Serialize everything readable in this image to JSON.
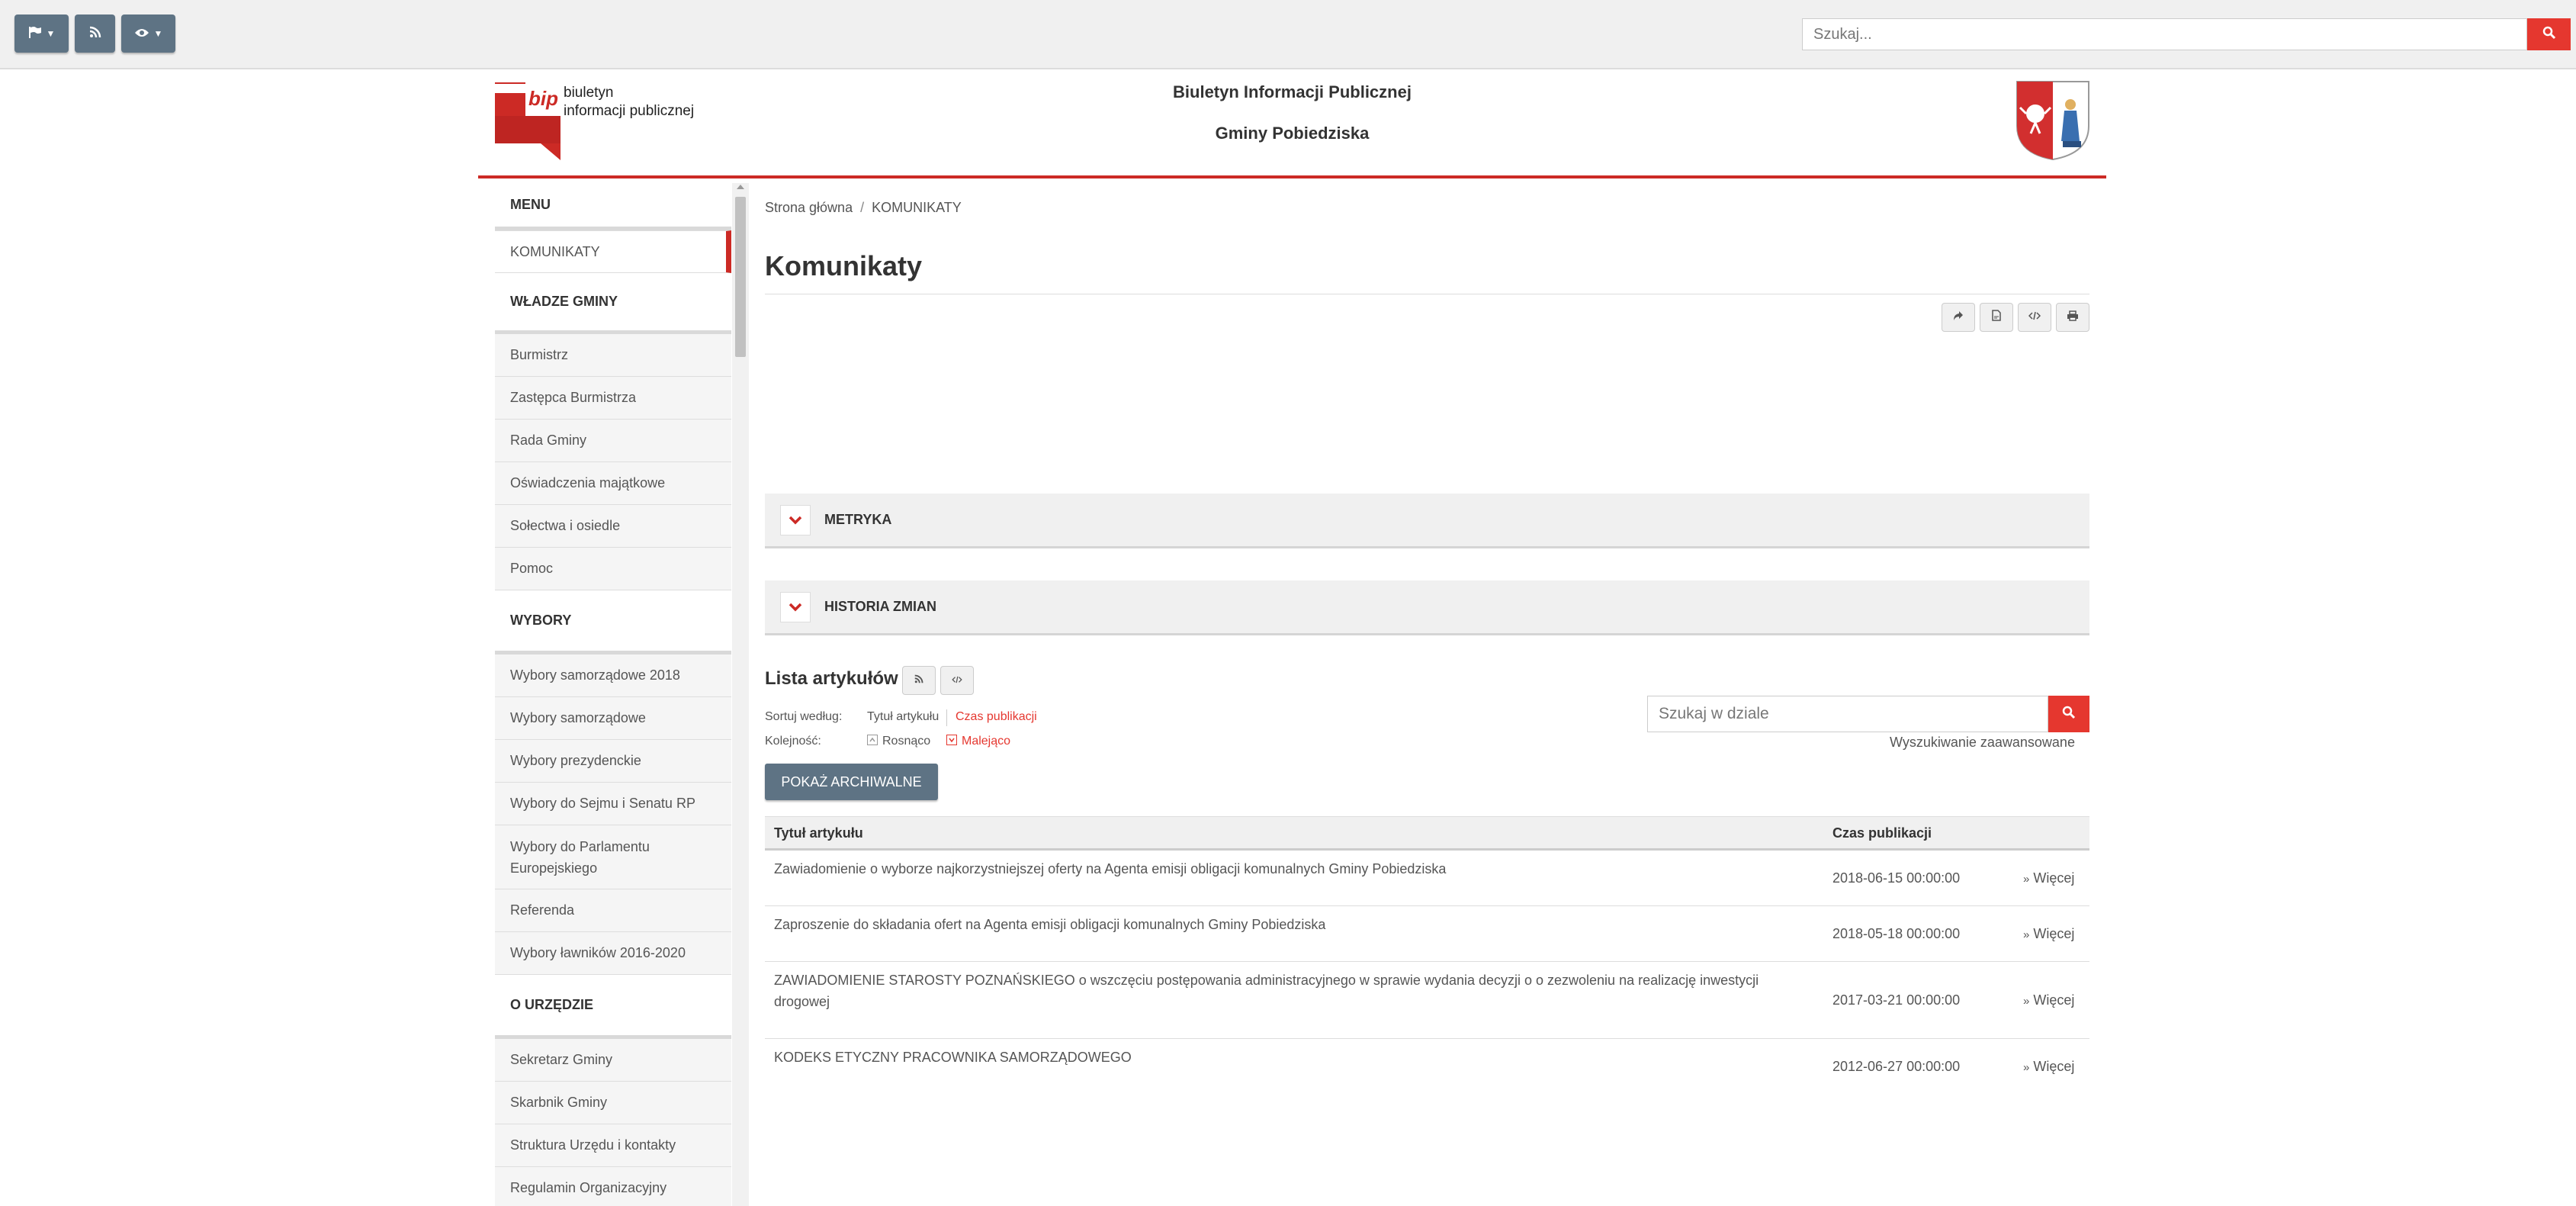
{
  "topbar": {
    "search_placeholder": "Szukaj..."
  },
  "header": {
    "logo_brand": "bip",
    "logo_line1": "biuletyn",
    "logo_line2": "informacji publicznej",
    "title_line1": "Biuletyn Informacji Publicznej",
    "title_line2": "Gminy Pobiedziska"
  },
  "sidebar": {
    "sections": [
      {
        "heading": "MENU",
        "items": [
          {
            "label": "KOMUNIKATY",
            "active": true
          }
        ]
      },
      {
        "heading": "WŁADZE GMINY",
        "items": [
          {
            "label": "Burmistrz"
          },
          {
            "label": "Zastępca Burmistrza"
          },
          {
            "label": "Rada Gminy"
          },
          {
            "label": "Oświadczenia majątkowe"
          },
          {
            "label": "Sołectwa i osiedle"
          },
          {
            "label": "Pomoc"
          }
        ]
      },
      {
        "heading": "WYBORY",
        "items": [
          {
            "label": "Wybory samorządowe 2018"
          },
          {
            "label": "Wybory samorządowe"
          },
          {
            "label": "Wybory prezydenckie"
          },
          {
            "label": "Wybory do Sejmu i Senatu RP"
          },
          {
            "label": "Wybory do Parlamentu Europejskiego"
          },
          {
            "label": "Referenda"
          },
          {
            "label": "Wybory ławników 2016-2020"
          }
        ]
      },
      {
        "heading": "O URZĘDZIE",
        "items": [
          {
            "label": "Sekretarz Gminy"
          },
          {
            "label": "Skarbnik Gminy"
          },
          {
            "label": "Struktura Urzędu i kontakty"
          },
          {
            "label": "Regulamin Organizacyjny"
          }
        ]
      }
    ]
  },
  "main": {
    "breadcrumb_home": "Strona główna",
    "breadcrumb_sep": "/",
    "breadcrumb_current": "KOMUNIKATY",
    "page_title": "Komunikaty",
    "metryka_label": "METRYKA",
    "historia_label": "HISTORIA ZMIAN",
    "list_title": "Lista artykułów",
    "sort_label": "Sortuj według:",
    "sort_title": "Tytuł artykułu",
    "sort_date": "Czas publikacji",
    "order_label": "Kolejność:",
    "order_asc": "Rosnąco",
    "order_desc": "Malejąco",
    "archive_button": "POKAŻ ARCHIWALNE",
    "section_search_placeholder": "Szukaj w dziale",
    "advanced_search": "Wyszukiwanie zaawansowane",
    "table": {
      "col_title": "Tytuł artykułu",
      "col_date": "Czas publikacji",
      "more_label": "Więcej",
      "rows": [
        {
          "title": "Zawiadomienie o wyborze najkorzystniejszej oferty na Agenta emisji obligacji komunalnych Gminy Pobiedziska",
          "date": "2018-06-15 00:00:00"
        },
        {
          "title": "Zaproszenie do składania ofert na Agenta emisji obligacji komunalnych Gminy Pobiedziska",
          "date": "2018-05-18 00:00:00"
        },
        {
          "title": "ZAWIADOMIENIE STAROSTY POZNAŃSKIEGO o wszczęciu postępowania administracyjnego w sprawie wydania decyzji o o zezwoleniu na realizację inwestycji drogowej",
          "date": "2017-03-21 00:00:00"
        },
        {
          "title": "KODEKS ETYCZNY PRACOWNIKA SAMORZĄDOWEGO",
          "date": "2012-06-27 00:00:00"
        }
      ]
    }
  },
  "colors": {
    "accent_red": "#e5372f",
    "header_rule": "#cc2a25",
    "button_slate": "#5e7384"
  }
}
